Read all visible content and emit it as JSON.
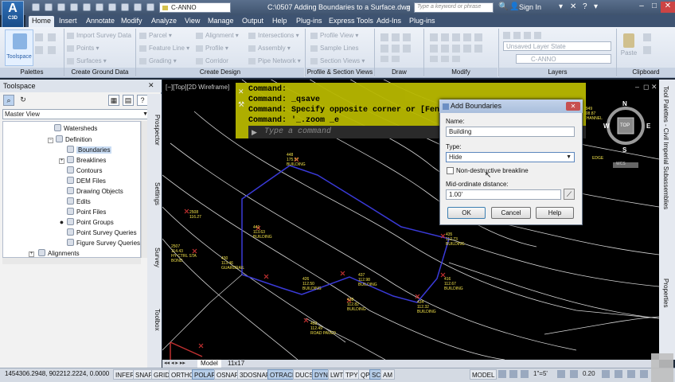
{
  "titlebar": {
    "app_logo": "A",
    "app_logo_sub": "C3D",
    "workspace": "C-ANNO",
    "document_title": "C:\\0507 Adding Boundaries to a Surface.dwg",
    "search_placeholder": "Type a keyword or phrase",
    "signin": "Sign In"
  },
  "ribbon_tabs": [
    "Home",
    "Insert",
    "Annotate",
    "Modify",
    "Analyze",
    "View",
    "Manage",
    "Output",
    "Help",
    "Plug-ins",
    "Express Tools",
    "Add-Ins",
    "Plug-ins"
  ],
  "ribbon": {
    "toolspace_label": "Toolspace",
    "import_survey_data": "Import Survey Data",
    "points": "Points",
    "surfaces": "Surfaces",
    "parcel": "Parcel",
    "feature_line": "Feature Line",
    "grading": "Grading",
    "alignment": "Alignment",
    "profile": "Profile",
    "corridor": "Corridor",
    "intersections": "Intersections",
    "assembly": "Assembly",
    "pipe_network": "Pipe Network",
    "profile_view": "Profile View",
    "sample_lines": "Sample Lines",
    "section_views": "Section Views",
    "layer_state": "Unsaved Layer State",
    "layer_current": "C-ANNO",
    "paste": "Paste",
    "panels": {
      "palettes": "Palettes",
      "create_ground_data": "Create Ground Data",
      "create_design": "Create Design",
      "profile_section_views": "Profile & Section Views",
      "draw": "Draw",
      "modify": "Modify",
      "layers": "Layers",
      "clipboard": "Clipboard"
    }
  },
  "toolspace": {
    "title": "Toolspace",
    "view_select": "Master View",
    "tree": [
      {
        "label": "Watersheds",
        "indent": 3
      },
      {
        "label": "Definition",
        "indent": 2
      },
      {
        "label": "Boundaries",
        "indent": 3,
        "selected": true
      },
      {
        "label": "Breaklines",
        "indent": 3
      },
      {
        "label": "Contours",
        "indent": 3
      },
      {
        "label": "DEM Files",
        "indent": 3
      },
      {
        "label": "Drawing Objects",
        "indent": 3
      },
      {
        "label": "Edits",
        "indent": 3
      },
      {
        "label": "Point Files",
        "indent": 3
      },
      {
        "label": "Point Groups",
        "indent": 3
      },
      {
        "label": "Point Survey Queries",
        "indent": 3
      },
      {
        "label": "Figure Survey Queries",
        "indent": 3
      },
      {
        "label": "Alignments",
        "indent": 1
      }
    ],
    "vertical_tabs": [
      "Prospector",
      "Settings",
      "Survey",
      "Toolbox"
    ]
  },
  "viewport": {
    "label": "[−][Top][2D Wireframe]"
  },
  "command_line": {
    "lines": [
      "Command:",
      "Command: _qsave",
      "Command: Specify opposite corner or [Fen",
      "Command: '_.zoom _e"
    ],
    "input_placeholder": "Type a command"
  },
  "dialog": {
    "title": "Add Boundaries",
    "name_label": "Name:",
    "name_value": "Building",
    "type_label": "Type:",
    "type_value": "Hide",
    "non_destructive_label": "Non-destructive breakline",
    "non_destructive_checked": false,
    "midordinate_label": "Mid-ordinate distance:",
    "midordinate_value": "1.00'",
    "ok": "OK",
    "cancel": "Cancel",
    "help": "Help"
  },
  "viewcube": {
    "n": "N",
    "s": "S",
    "e": "E",
    "w": "W",
    "top": "TOP",
    "wcs": "WCS"
  },
  "right_bar": [
    "Tool Palettes - Civil Imperial Subassemblies",
    "Properties"
  ],
  "layout_tabs": [
    "Model",
    "11x17"
  ],
  "statusbar": {
    "coords": "1454306.2948, 902212.2224, 0.0000",
    "buttons": [
      {
        "label": "INFER",
        "on": false
      },
      {
        "label": "SNAP",
        "on": false
      },
      {
        "label": "GRID",
        "on": false
      },
      {
        "label": "ORTHO",
        "on": false
      },
      {
        "label": "POLAR",
        "on": true
      },
      {
        "label": "OSNAP",
        "on": false
      },
      {
        "label": "3DOSNAP",
        "on": false
      },
      {
        "label": "OTRACK",
        "on": true
      },
      {
        "label": "DUCS",
        "on": false
      },
      {
        "label": "DYN",
        "on": true
      },
      {
        "label": "LWT",
        "on": false
      },
      {
        "label": "TPY",
        "on": false
      },
      {
        "label": "QP",
        "on": false
      },
      {
        "label": "SC",
        "on": true
      },
      {
        "label": "AM",
        "on": false
      }
    ],
    "model": "MODEL",
    "scale": "1\"=5'",
    "zoom_value": "0.20"
  },
  "drawing_labels": [
    {
      "t": "448\n175.97\nBUILDING"
    },
    {
      "t": "441\n113.63\nBUILDING"
    },
    {
      "t": "434\n112.32\nBUILDING"
    },
    {
      "t": "426\n112.50\nBUILDING"
    },
    {
      "t": "437\n112.98\nBUILDING"
    },
    {
      "t": "438\n112.82\nBUILDING"
    },
    {
      "t": "435\n112.73\nBUILDING"
    },
    {
      "t": "493\n112.49\nROAD PAVED"
    },
    {
      "t": "430\n113.46\nGUARDRAIL"
    },
    {
      "t": "2507\n114.43\nHY CTRL STA\nBOND"
    },
    {
      "t": "2508\n116.27"
    },
    {
      "t": "416\n112.67\nBUILDING"
    },
    {
      "t": "2949\n108.87\nCHANNEL"
    },
    {
      "t": "EDGE"
    }
  ],
  "colors": {
    "cmd_bg": "#b8b800",
    "contour": "#d6d6d6",
    "boundary": "#3a3ad8",
    "label": "#f2e24a"
  }
}
